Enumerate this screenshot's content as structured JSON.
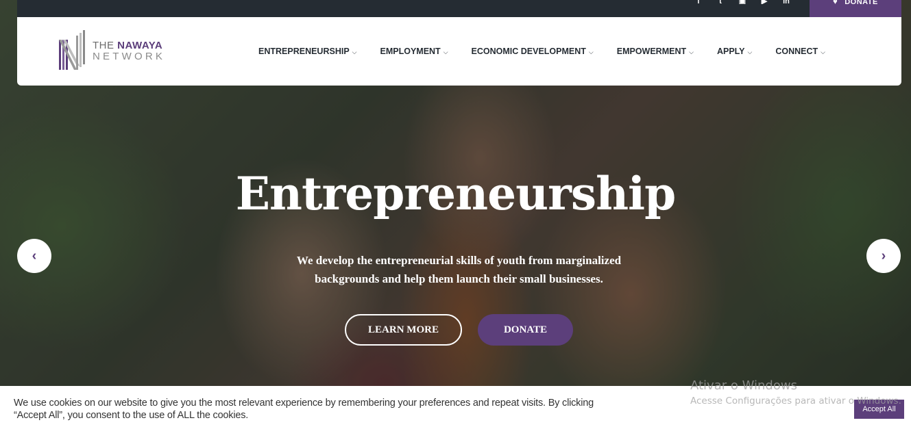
{
  "topbar": {
    "social_icons": [
      "facebook-icon",
      "twitter-icon",
      "instagram-icon",
      "youtube-icon",
      "linkedin-icon"
    ],
    "donate_label": "DONATE"
  },
  "logo": {
    "line1_prefix": "THE ",
    "line1_brand": "NAWAYA",
    "line2": "NETWORK"
  },
  "menu": {
    "items": [
      {
        "label": "ENTREPRENEURSHIP"
      },
      {
        "label": "EMPLOYMENT"
      },
      {
        "label": "ECONOMIC DEVELOPMENT"
      },
      {
        "label": "EMPOWERMENT"
      },
      {
        "label": "APPLY"
      },
      {
        "label": "CONNECT"
      }
    ]
  },
  "hero": {
    "title": "Entrepreneurship",
    "subtitle_line1": "We develop the entrepreneurial skills of youth from marginalized",
    "subtitle_line2": "backgrounds and help them launch their small businesses.",
    "learn_more_label": "LEARN MORE",
    "donate_label": "DONATE"
  },
  "cookie": {
    "text_line1": "We use cookies on our website to give you the most relevant experience by remembering your preferences and repeat visits. By clicking",
    "text_line2": "“Accept All”, you consent to the use of ALL the cookies.",
    "accept_label": "Accept All"
  },
  "windows_watermark": {
    "line1": "Ativar o Windows",
    "line2": "Acesse Configurações para ativar o Windows."
  },
  "colors": {
    "brand_purple": "#5c3f7b",
    "topbar_dark": "#252c33",
    "nav_text": "#252c33"
  }
}
